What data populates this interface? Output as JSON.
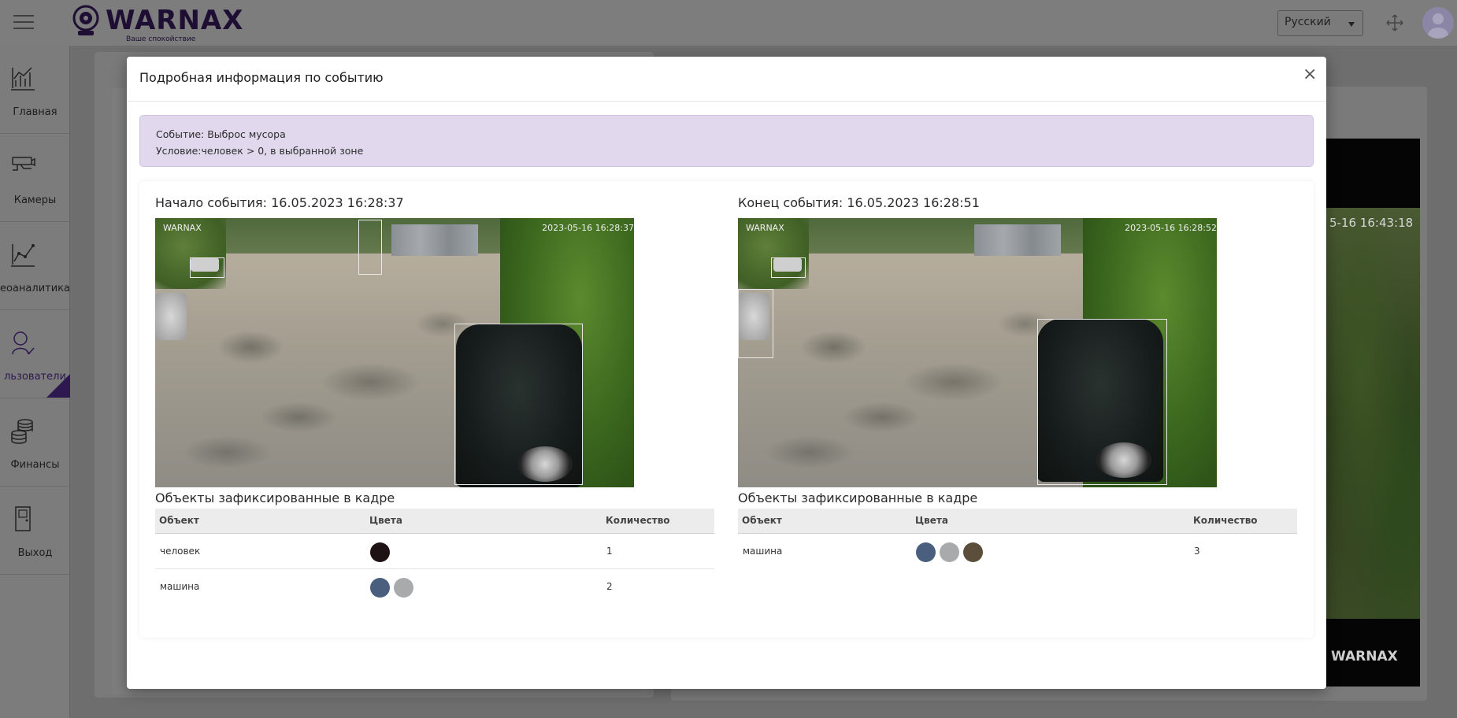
{
  "app": {
    "brand": "WARNAX",
    "tagline": "Ваше спокойствие",
    "language": "Русский"
  },
  "sidebar": {
    "items": [
      {
        "label": "Главная",
        "icon": "chart-icon"
      },
      {
        "label": "Камеры",
        "icon": "camera-icon"
      },
      {
        "label": "еоаналитика",
        "icon": "analytics-icon"
      },
      {
        "label": "льзователи",
        "icon": "user-icon"
      },
      {
        "label": "Финансы",
        "icon": "coins-icon"
      },
      {
        "label": "Выход",
        "icon": "exit-icon"
      }
    ]
  },
  "background_video": {
    "timestamp": "5-16 16:43:18",
    "logo": "WARNAX"
  },
  "modal": {
    "title": "Подробная информация по событию",
    "close": "×",
    "alert": {
      "event": "Событие: Выброс мусора",
      "condition": "Условие:человек > 0, в выбранной зоне"
    },
    "start": {
      "title": "Начало события: 16.05.2023 16:28:37",
      "osd_logo": "WARNAX",
      "osd_timestamp": "2023-05-16 16:28:37",
      "objects_title": "Объекты зафиксированные в кадре",
      "columns": {
        "object": "Объект",
        "colors": "Цвета",
        "count": "Количество"
      },
      "rows": [
        {
          "object": "человек",
          "colors": [
            "#1f1214"
          ],
          "count": "1"
        },
        {
          "object": "машина",
          "colors": [
            "#4a5f7d",
            "#a8aaab"
          ],
          "count": "2"
        }
      ]
    },
    "end": {
      "title": "Конец события: 16.05.2023 16:28:51",
      "osd_logo": "WARNAX",
      "osd_timestamp": "2023-05-16 16:28:52",
      "objects_title": "Объекты зафиксированные в кадре",
      "columns": {
        "object": "Объект",
        "colors": "Цвета",
        "count": "Количество"
      },
      "rows": [
        {
          "object": "машина",
          "colors": [
            "#4a5f7d",
            "#a8aaab",
            "#5b4e3b"
          ],
          "count": "3"
        }
      ]
    }
  },
  "colors": {
    "brand": "#1e0e33",
    "alert_bg": "#e1d8ee",
    "overlay": "#6e6e6e"
  }
}
